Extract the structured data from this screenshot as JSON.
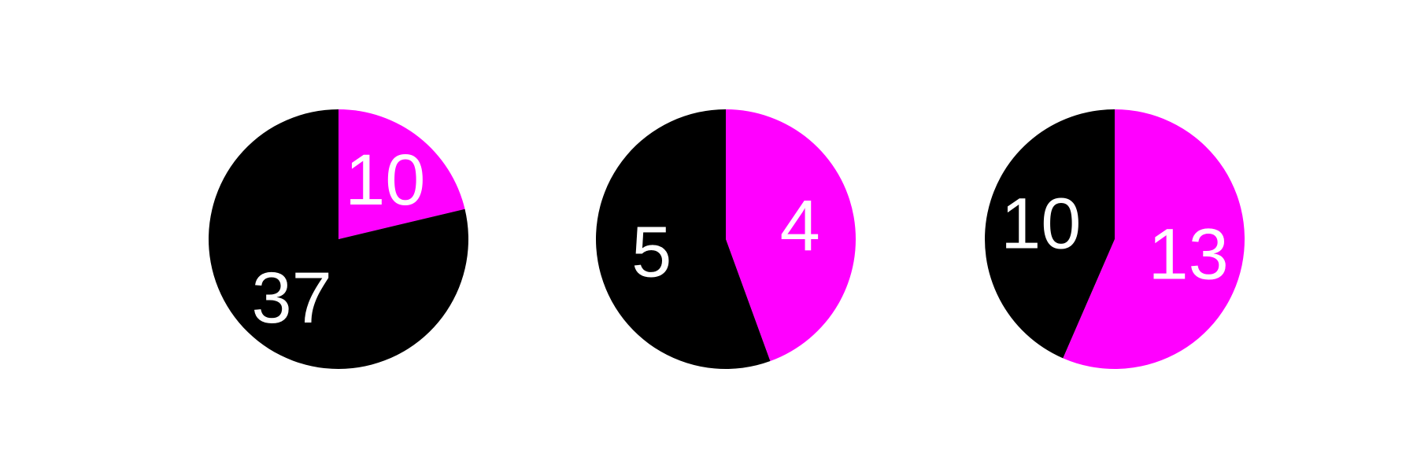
{
  "chart_data": [
    {
      "type": "pie",
      "colors": [
        "#ff00ff",
        "#000000"
      ],
      "slices": [
        {
          "value": 10,
          "label": "10",
          "color": "#ff00ff"
        },
        {
          "value": 37,
          "label": "37",
          "color": "#000000"
        }
      ]
    },
    {
      "type": "pie",
      "colors": [
        "#ff00ff",
        "#000000"
      ],
      "slices": [
        {
          "value": 4,
          "label": "4",
          "color": "#ff00ff"
        },
        {
          "value": 5,
          "label": "5",
          "color": "#000000"
        }
      ]
    },
    {
      "type": "pie",
      "colors": [
        "#ff00ff",
        "#000000"
      ],
      "slices": [
        {
          "value": 13,
          "label": "13",
          "color": "#ff00ff"
        },
        {
          "value": 10,
          "label": "10",
          "color": "#000000"
        }
      ]
    }
  ]
}
